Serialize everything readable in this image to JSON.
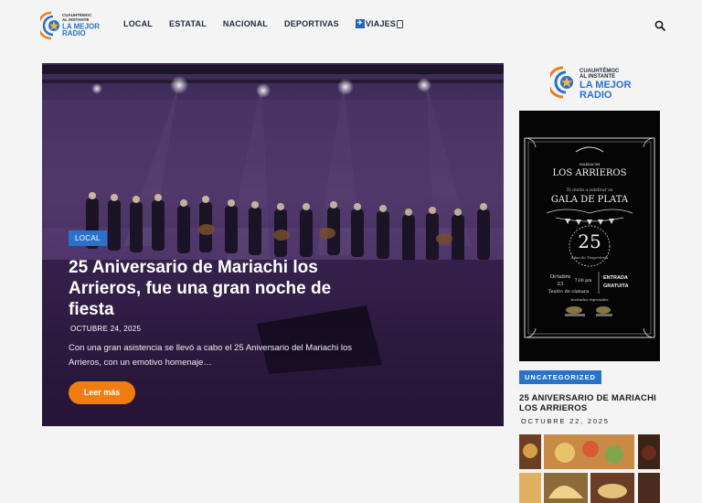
{
  "brand": {
    "line1": "CUAUHTÉMOC",
    "line2": "AL INSTANTE",
    "line3": "LA MEJOR",
    "line4": "RADIO"
  },
  "nav": {
    "items": [
      {
        "label": "LOCAL"
      },
      {
        "label": "ESTATAL"
      },
      {
        "label": "NACIONAL"
      },
      {
        "label": "DEPORTIVAS"
      },
      {
        "label": "VIAJES"
      }
    ]
  },
  "hero": {
    "category": "LOCAL",
    "title": "25 Aniversario de Mariachi los Arrieros, fue una gran noche de fiesta",
    "date": "OCTUBRE 24, 2025",
    "excerpt": "Con una gran asistencia se llevó a cabo el 25 Aniversario del Mariachi los Arrieros, con un emotivo homenaje…",
    "button": "Leer más"
  },
  "sidebar": {
    "poster": {
      "brand_small": "MARIACHI",
      "brand": "LOS ARRIEROS",
      "invite": "Te invita a celebrar su",
      "event": "GALA DE PLATA",
      "number": "25",
      "years": "Años de Trayectoria",
      "month": "Octubre",
      "day": "23",
      "time": "7:00 pm",
      "venue": "Teatro de cámara",
      "entry1": "ENTRADA",
      "entry2": "GRATUITA",
      "guests": "Invitados especiales"
    },
    "category": "UNCATEGORIZED",
    "title": "25 ANIVERSARIO DE MARIACHI LOS ARRIEROS",
    "date": "OCTUBRE 22, 2025"
  },
  "colors": {
    "accent_blue": "#2a72c8",
    "button_orange": "#f07d12",
    "nav_text": "#1f2a3a"
  }
}
